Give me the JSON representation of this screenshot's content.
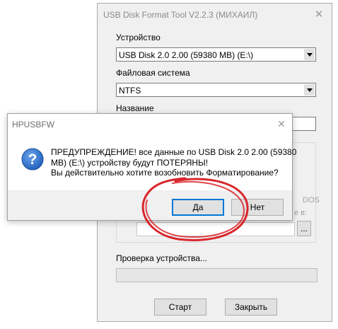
{
  "main_window": {
    "title": "USB Disk Format Tool V2.2.3 (МИХАИЛ)",
    "device": {
      "label": "Устройство",
      "value": "USB Disk 2.0 2.00 (59380 MB) (E:\\)"
    },
    "filesystem": {
      "label": "Файловая система",
      "value": "NTFS"
    },
    "name": {
      "label": "Название",
      "value": ""
    },
    "options_partial": {
      "dos_fragment": "DOS",
      "path_fragment": "е в:",
      "browse_label": "..."
    },
    "verify": {
      "label": "Проверка устройства..."
    },
    "buttons": {
      "start": "Старт",
      "close": "Закрыть"
    }
  },
  "dialog": {
    "title": "HPUSBFW",
    "message_lines": [
      "ПРЕДУПРЕЖДЕНИЕ! все данные по USB Disk 2.0 2.00 (59380",
      "MB) (E:\\) устройству будут ПОТЕРЯНЫ!",
      "Вы действительно хотите возобновить Форматирование?"
    ],
    "buttons": {
      "yes": "Да",
      "no": "Нет"
    }
  },
  "colors": {
    "window_bg": "#f0f0f0",
    "annotation_red": "#d9262c",
    "focus_blue": "#0078d7",
    "icon_blue": "#1f5fb8"
  },
  "icons": {
    "dialog_icon": "question-icon",
    "close": "close-icon",
    "dropdown": "chevron-down-icon"
  }
}
